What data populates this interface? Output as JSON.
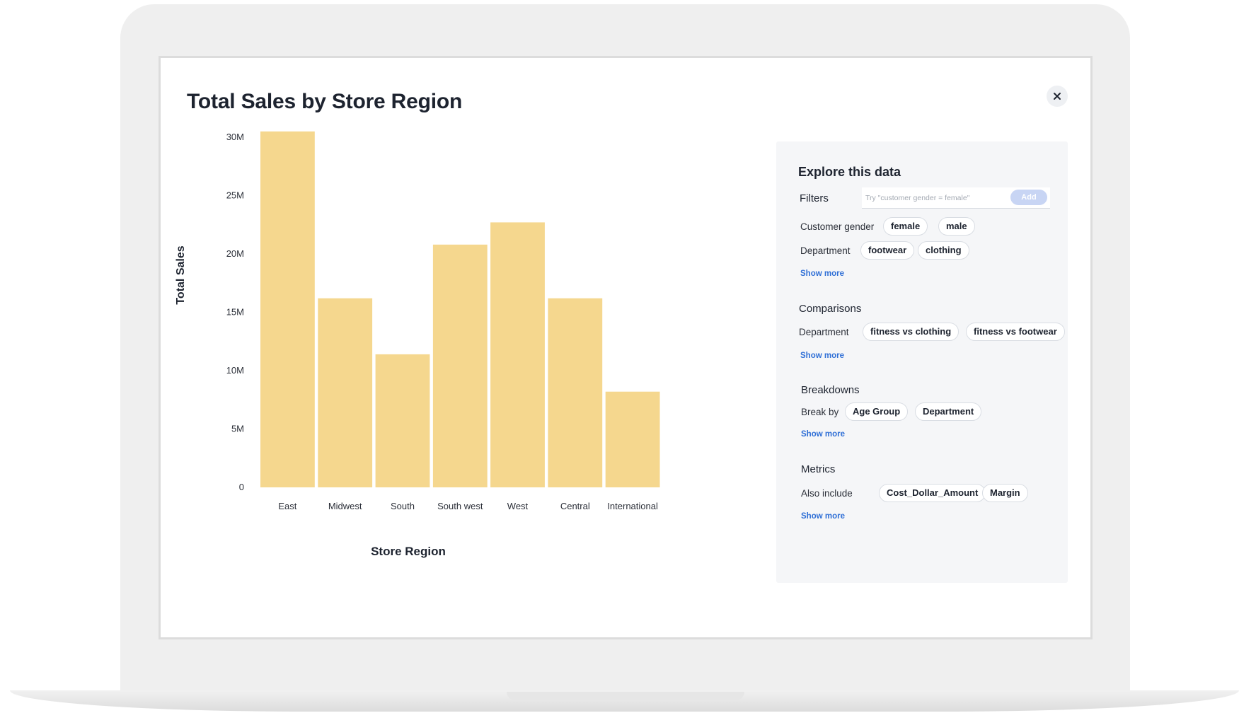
{
  "page": {
    "title": "Total Sales by Store Region",
    "close_symbol": "×"
  },
  "chart_data": {
    "type": "bar",
    "title": "Total Sales by Store Region",
    "xlabel": "Store Region",
    "ylabel": "Total Sales",
    "categories": [
      "East",
      "Midwest",
      "South",
      "South west",
      "West",
      "Central",
      "International"
    ],
    "values": [
      30500000,
      16200000,
      11400000,
      20800000,
      22700000,
      16200000,
      8200000
    ],
    "ylim": [
      0,
      30000000
    ],
    "yticks": [
      0,
      5000000,
      10000000,
      15000000,
      20000000,
      25000000,
      30000000
    ],
    "ytick_labels": [
      "0",
      "5M",
      "10M",
      "15M",
      "20M",
      "25M",
      "30M"
    ],
    "bar_color": "#f5d78e",
    "grid": false,
    "legend": false
  },
  "explore": {
    "title": "Explore this data",
    "filters": {
      "label": "Filters",
      "placeholder": "Try \"customer gender = female\"",
      "add_label": "Add",
      "rows": [
        {
          "label": "Customer gender",
          "chips": [
            "female",
            "male"
          ]
        },
        {
          "label": "Department",
          "chips": [
            "footwear",
            "clothing"
          ]
        }
      ],
      "show_more": "Show more"
    },
    "comparisons": {
      "label": "Comparisons",
      "row_label": "Department",
      "chips": [
        "fitness vs clothing",
        "fitness vs footwear"
      ],
      "show_more": "Show more"
    },
    "breakdowns": {
      "label": "Breakdowns",
      "row_label": "Break by",
      "chips": [
        "Age Group",
        "Department"
      ],
      "show_more": "Show more"
    },
    "metrics": {
      "label": "Metrics",
      "row_label": "Also include",
      "chips": [
        "Cost_Dollar_Amount",
        "Margin"
      ],
      "show_more": "Show more"
    }
  },
  "colors": {
    "accent_link": "#2f6fd6",
    "add_button": "#c8d5f4",
    "panel_bg": "#f5f6f8"
  },
  "icons": {
    "close": "close-icon"
  }
}
